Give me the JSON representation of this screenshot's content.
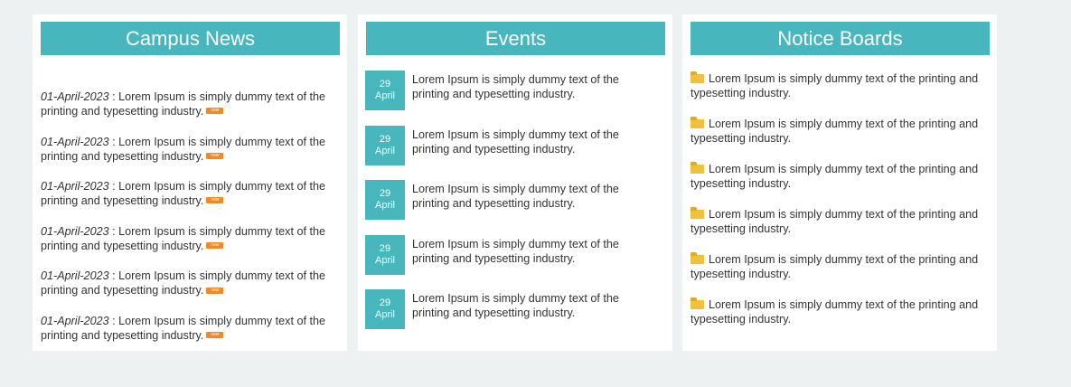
{
  "news": {
    "title": "Campus News",
    "badge_label": "new",
    "items": [
      {
        "date": "01-April-2023",
        "text": " : Lorem Ipsum is simply dummy text of the printing and typesetting industry."
      },
      {
        "date": "01-April-2023",
        "text": " : Lorem Ipsum is simply dummy text of the printing and typesetting industry."
      },
      {
        "date": "01-April-2023",
        "text": " : Lorem Ipsum is simply dummy text of the printing and typesetting industry."
      },
      {
        "date": "01-April-2023",
        "text": " : Lorem Ipsum is simply dummy text of the printing and typesetting industry."
      },
      {
        "date": "01-April-2023",
        "text": " : Lorem Ipsum is simply dummy text of the printing and typesetting industry."
      },
      {
        "date": "01-April-2023",
        "text": " : Lorem Ipsum is simply dummy text of the printing and typesetting industry."
      }
    ]
  },
  "events": {
    "title": "Events",
    "items": [
      {
        "day": "29",
        "month": "April",
        "text": "Lorem Ipsum is simply dummy text of the printing and typesetting industry."
      },
      {
        "day": "29",
        "month": "April",
        "text": "Lorem Ipsum is simply dummy text of the printing and typesetting industry."
      },
      {
        "day": "29",
        "month": "April",
        "text": "Lorem Ipsum is simply dummy text of the printing and typesetting industry."
      },
      {
        "day": "29",
        "month": "April",
        "text": "Lorem Ipsum is simply dummy text of the printing and typesetting industry."
      },
      {
        "day": "29",
        "month": "April",
        "text": "Lorem Ipsum is simply dummy text of the printing and typesetting industry."
      }
    ]
  },
  "notices": {
    "title": "Notice Boards",
    "icon": "folder-icon",
    "items": [
      {
        "text": "Lorem Ipsum is simply dummy text of the printing and typesetting industry."
      },
      {
        "text": "Lorem Ipsum is simply dummy text of the printing and typesetting industry."
      },
      {
        "text": "Lorem Ipsum is simply dummy text of the printing and typesetting industry."
      },
      {
        "text": "Lorem Ipsum is simply dummy text of the printing and typesetting industry."
      },
      {
        "text": "Lorem Ipsum is simply dummy text of the printing and typesetting industry."
      },
      {
        "text": "Lorem Ipsum is simply dummy text of the printing and typesetting industry."
      }
    ]
  },
  "colors": {
    "header_bg": "#47b6bd",
    "badge_bg": "#ef8a2c",
    "folder": "#f0c13a",
    "page_bg": "#eef1f1"
  }
}
